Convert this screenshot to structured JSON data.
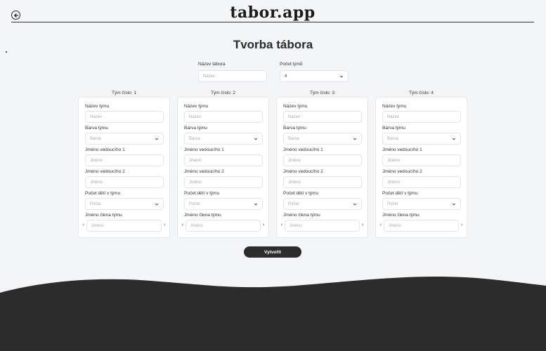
{
  "header": {
    "logo": "tabor.app"
  },
  "page": {
    "title": "Tvorba tábora"
  },
  "camp": {
    "name_label": "Název tábora",
    "name_placeholder": "Název",
    "team_count_label": "Počet týmů",
    "team_count_value": "4"
  },
  "teams": [
    {
      "heading": "Tým číslo: 1"
    },
    {
      "heading": "Tým číslo: 2"
    },
    {
      "heading": "Tým číslo: 3"
    },
    {
      "heading": "Tým číslo: 4"
    }
  ],
  "team_form": {
    "name_label": "Název týmu",
    "name_placeholder": "Název",
    "color_label": "Barva týmu",
    "color_placeholder": "Barva",
    "leader1_label": "Jméno vedoucího 1",
    "leader2_label": "Jméno vedoucího 2",
    "leader_placeholder": "Jméno",
    "kids_label": "Počet dětí v týmu",
    "kids_placeholder": "Počet",
    "member_label": "Jméno člena týmu",
    "member_placeholder": "Jméno",
    "prev_arrow": "‹",
    "next_arrow": "›"
  },
  "actions": {
    "create_label": "Vytvořit"
  },
  "colors": {
    "dark": "#2c2c2c",
    "background": "#f4f5f7"
  }
}
